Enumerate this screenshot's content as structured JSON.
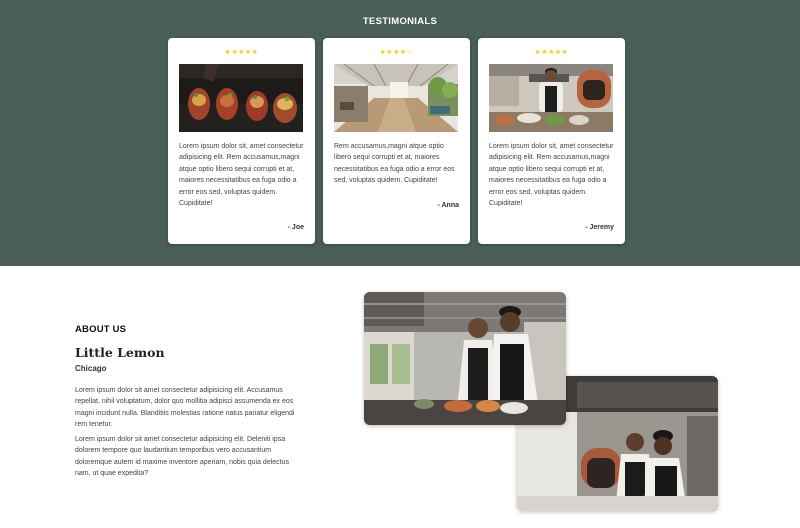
{
  "testimonials": {
    "title": "TESTIMONIALS",
    "cards": [
      {
        "stars": "★★★★★",
        "rating": 5,
        "image_icon": "food-plate-photo",
        "text": "Lorem ipsum dolor sit, amet consectetur adipisicing elit. Rem accusamus,magni atque optio libero sequi corrupti et at, maiores necessitatibus ea fuga odio a error eos sed, voluptas quidem. Cupiditate!",
        "author": "- Joe"
      },
      {
        "stars": "★★★★☆",
        "rating": 4,
        "image_icon": "restaurant-interior-photo",
        "text": "Rem accusamus,magni atque optio libero sequi corrupti et at, maiores necessitatibus ea fuga odio a error eos sed, voluptas quidem. Cupiditate!",
        "author": "- Anna"
      },
      {
        "stars": "★★★★★",
        "rating": 5,
        "image_icon": "chef-kitchen-photo",
        "text": "Lorem ipsum dolor sit, amet consectetur adipisicing elit. Rem accusamus,magni atque optio libero sequi corrupti et at, maiores necessitatibus ea fuga odio a error eos sed, voluptas quidem. Cupiditate!",
        "author": "- Jeremy"
      }
    ]
  },
  "about": {
    "heading": "ABOUT US",
    "title": "Little Lemon",
    "city": "Chicago",
    "paragraph1": "Lorem ipsum dolor sit amet consectetur adipisicing elit. Accusamus repellat, nihil voluptatum, dolor quo mollitia adipisci assumenda ex eos magni incidunt nulla. Blanditiis molestias ratione natus pariatur eligendi rem tenetur.",
    "paragraph2": "Lorem ipsum dolor sit amet consectetur adipisicing elit. Deleniti ipsa dolorem tempore quo laudantium temporibus vero accusantium doloremque autem id maxime inventore aperiam, nobis quia delectus nam, ut quae expedita?"
  },
  "colors": {
    "testimonials_bg": "#495e57",
    "star": "#f4ce14",
    "card_bg": "#ffffff"
  }
}
